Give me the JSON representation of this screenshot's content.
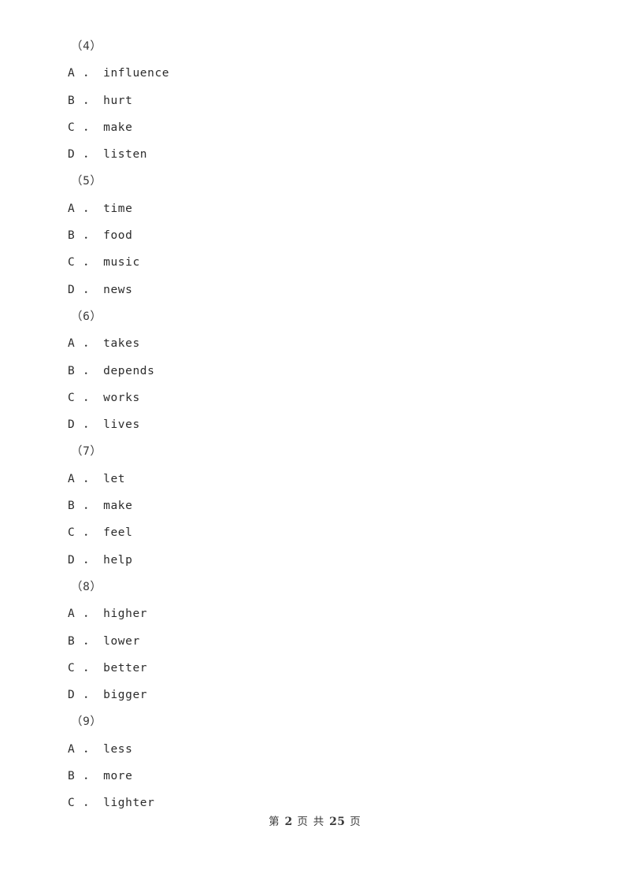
{
  "document": {
    "type": "exam-paper",
    "background_color": "#ffffff",
    "text_color": "#2b2b2b"
  },
  "questions": [
    {
      "number": "（4）",
      "options": [
        {
          "letter": "A",
          "separator": "．",
          "text": "influence"
        },
        {
          "letter": "B",
          "separator": "．",
          "text": "hurt"
        },
        {
          "letter": "C",
          "separator": "．",
          "text": "make"
        },
        {
          "letter": "D",
          "separator": "．",
          "text": "listen"
        }
      ]
    },
    {
      "number": "（5）",
      "options": [
        {
          "letter": "A",
          "separator": "．",
          "text": "time"
        },
        {
          "letter": "B",
          "separator": "．",
          "text": "food"
        },
        {
          "letter": "C",
          "separator": "．",
          "text": "music"
        },
        {
          "letter": "D",
          "separator": "．",
          "text": "news"
        }
      ]
    },
    {
      "number": "（6）",
      "options": [
        {
          "letter": "A",
          "separator": "．",
          "text": "takes"
        },
        {
          "letter": "B",
          "separator": "．",
          "text": "depends"
        },
        {
          "letter": "C",
          "separator": "．",
          "text": "works"
        },
        {
          "letter": "D",
          "separator": "．",
          "text": "lives"
        }
      ]
    },
    {
      "number": "（7）",
      "options": [
        {
          "letter": "A",
          "separator": "．",
          "text": "let"
        },
        {
          "letter": "B",
          "separator": "．",
          "text": "make"
        },
        {
          "letter": "C",
          "separator": "．",
          "text": "feel"
        },
        {
          "letter": "D",
          "separator": "．",
          "text": "help"
        }
      ]
    },
    {
      "number": "（8）",
      "options": [
        {
          "letter": "A",
          "separator": "．",
          "text": "higher"
        },
        {
          "letter": "B",
          "separator": "．",
          "text": "lower"
        },
        {
          "letter": "C",
          "separator": "．",
          "text": "better"
        },
        {
          "letter": "D",
          "separator": "．",
          "text": "bigger"
        }
      ]
    },
    {
      "number": "（9）",
      "options": [
        {
          "letter": "A",
          "separator": "．",
          "text": "less"
        },
        {
          "letter": "B",
          "separator": "．",
          "text": "more"
        },
        {
          "letter": "C",
          "separator": "．",
          "text": "lighter"
        }
      ]
    }
  ],
  "footer": {
    "prefix": "第",
    "current_page": "2",
    "page_unit_1": "页",
    "total_label": "共",
    "total_pages": "25",
    "page_unit_2": "页"
  }
}
